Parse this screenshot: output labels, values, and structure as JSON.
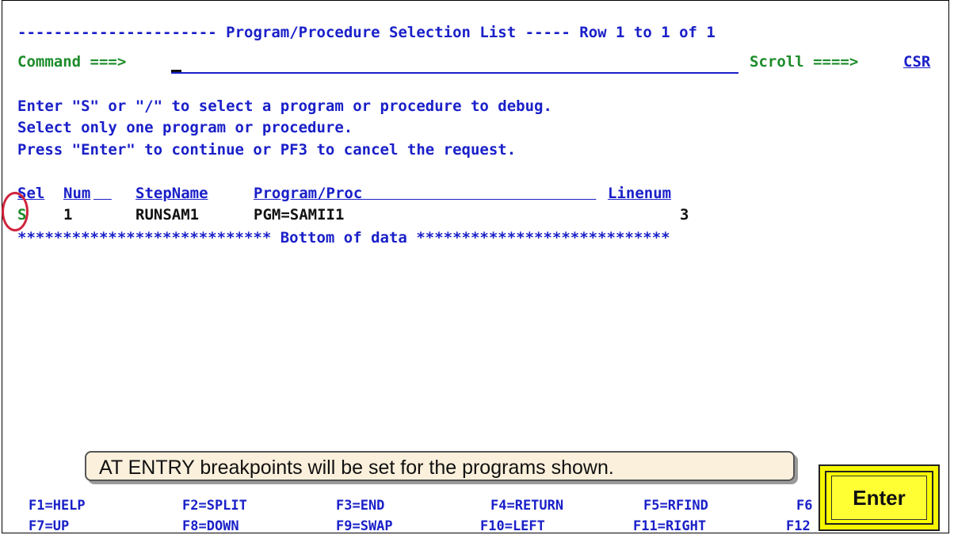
{
  "title_line": {
    "prefix": "----------------------",
    "title": "Program/Procedure Selection List",
    "mid": "-----",
    "row_info": "Row 1 to 1 of 1"
  },
  "command": {
    "label": "Command ===>",
    "value": "",
    "scroll_label": "Scroll ====>",
    "scroll_value": "CSR"
  },
  "instructions": [
    "Enter \"S\" or \"/\" to select a program or procedure to debug.",
    "Select only one program or procedure.",
    "Press \"Enter\" to continue or PF3 to cancel the request."
  ],
  "table": {
    "headers": {
      "sel": "Sel",
      "num": "Num",
      "stepname": "StepName",
      "program": "Program/Proc",
      "linenum": "Linenum"
    },
    "rows": [
      {
        "sel": "S",
        "num": "1",
        "stepname": "RUNSAM1",
        "program": "PGM=SAMII1",
        "linenum": "3"
      }
    ],
    "bottom_marker": "**************************** Bottom of data ****************************"
  },
  "callout_text": "AT ENTRY breakpoints will be set for the programs shown.",
  "function_keys": {
    "row1": [
      "F1=HELP",
      "F2=SPLIT",
      "F3=END",
      "F4=RETURN",
      "F5=RFIND",
      "F6"
    ],
    "row2": [
      "F7=UP",
      "F8=DOWN",
      "F9=SWAP",
      "F10=LEFT",
      "F11=RIGHT",
      "F12"
    ]
  },
  "enter_key_label": "Enter",
  "colors": {
    "field_blue": "#1a20c8",
    "label_green": "#1c8c2a",
    "highlight_red": "#d0243c",
    "key_yellow": "#ffff00"
  }
}
